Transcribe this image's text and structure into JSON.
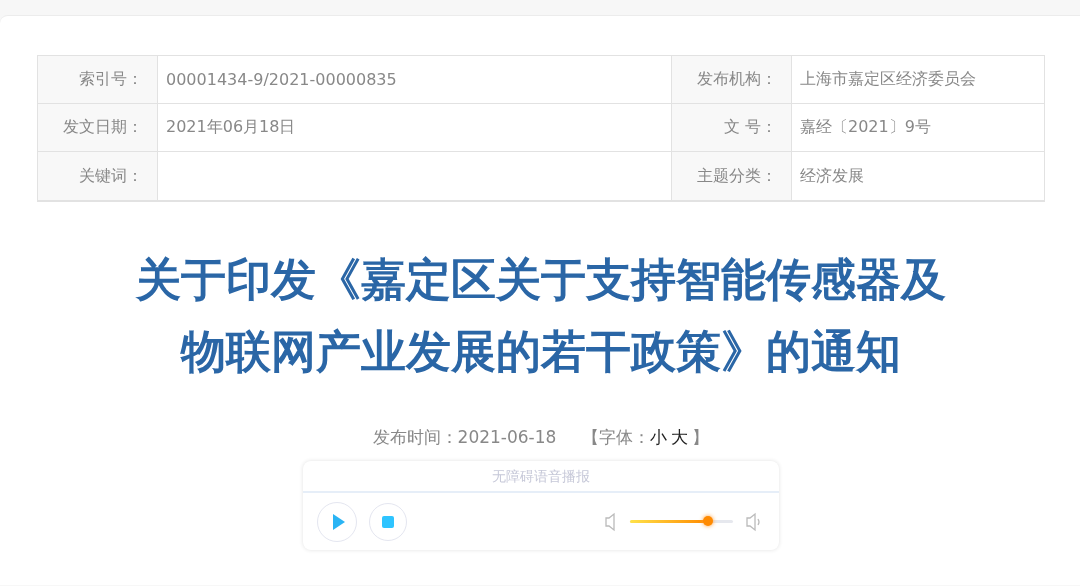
{
  "info_table": {
    "rows": [
      {
        "cells": [
          {
            "label": "索引号：",
            "value": "00001434-9/2021-00000835"
          },
          {
            "label": "发布机构：",
            "value": "上海市嘉定区经济委员会"
          }
        ]
      },
      {
        "cells": [
          {
            "label": "发文日期：",
            "value": "2021年06月18日"
          },
          {
            "label": "文 号：",
            "value": "嘉经〔2021〕9号"
          }
        ]
      },
      {
        "cells": [
          {
            "label": "关键词："
          },
          {
            "label": "主题分类：",
            "value": "经济发展"
          }
        ]
      }
    ]
  },
  "title": {
    "lines": [
      "关于印发《嘉定区关于支持智能传感器及",
      "物联网产业发展的若干政策》的通知"
    ]
  },
  "meta": {
    "publish_time": "发布时间：2021-06-18",
    "font_open": "【字体：",
    "font_options": [
      "小",
      "大"
    ],
    "font_close": "】"
  },
  "player": {
    "header": "无障碍语音播报",
    "volume": {
      "level": 0.76
    }
  }
}
